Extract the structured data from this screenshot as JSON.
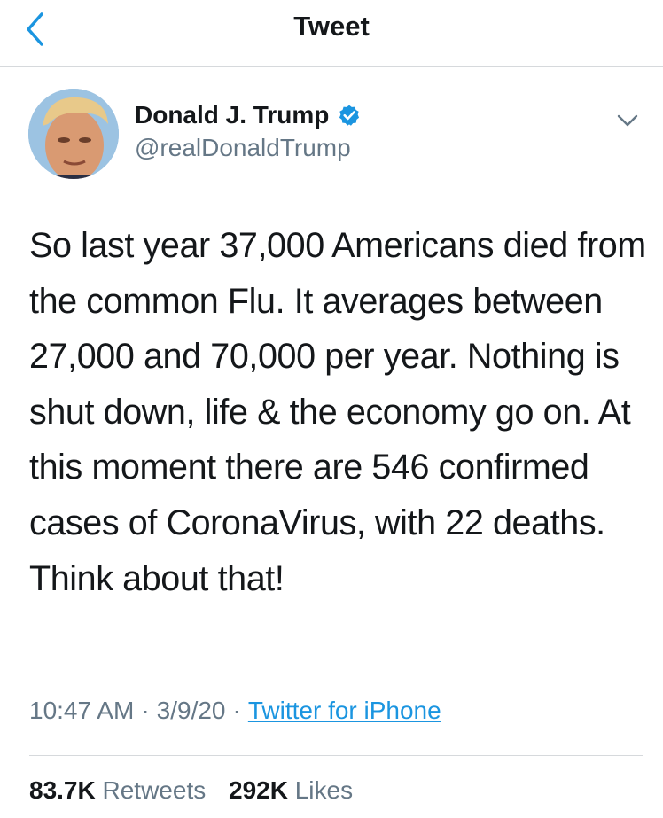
{
  "header": {
    "title": "Tweet",
    "back_icon": "chevron-left-icon"
  },
  "author": {
    "name": "Donald J. Trump",
    "handle": "@realDonaldTrump",
    "verified_icon": "verified-badge-icon",
    "menu_icon": "chevron-down-icon"
  },
  "tweet": {
    "text": "So last year 37,000 Americans died from the common Flu. It averages between 27,000 and 70,000 per year. Nothing is shut down, life & the economy go on. At this moment there are 546 confirmed cases of CoronaVirus, with 22 deaths. Think about that!",
    "time": "10:47 AM",
    "date": "3/9/20",
    "separator": "·",
    "source": "Twitter for iPhone"
  },
  "stats": {
    "retweets_count": "83.7K",
    "retweets_label": "Retweets",
    "likes_count": "292K",
    "likes_label": "Likes"
  },
  "colors": {
    "accent": "#1b95e0",
    "text": "#14171a",
    "secondary": "#657786",
    "divider": "#d6d9dc"
  }
}
